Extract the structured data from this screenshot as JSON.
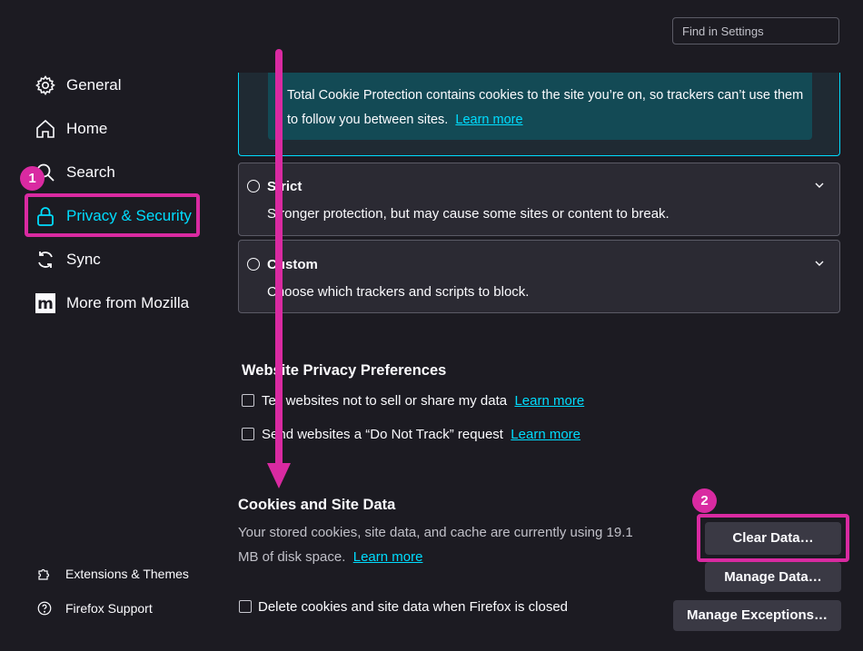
{
  "search": {
    "placeholder": "Find in Settings"
  },
  "sidebar": {
    "items": [
      {
        "label": "General",
        "icon": "gear-icon"
      },
      {
        "label": "Home",
        "icon": "home-icon"
      },
      {
        "label": "Search",
        "icon": "search-icon"
      },
      {
        "label": "Privacy & Security",
        "icon": "lock-icon",
        "active": true
      },
      {
        "label": "Sync",
        "icon": "sync-icon"
      },
      {
        "label": "More from Mozilla",
        "icon": "mozilla-icon"
      }
    ],
    "footer": [
      {
        "label": "Extensions & Themes",
        "icon": "puzzle-icon"
      },
      {
        "label": "Firefox Support",
        "icon": "help-icon"
      }
    ]
  },
  "annotations": {
    "step1": "1",
    "step2": "2",
    "accent": "#d92aa1"
  },
  "tracking": {
    "tcp_text": "Total Cookie Protection contains cookies to the site you’re on, so trackers can’t use them to follow you between sites.",
    "tcp_link": "Learn more",
    "options": [
      {
        "title": "Strict",
        "description": "Stronger protection, but may cause some sites or content to break."
      },
      {
        "title": "Custom",
        "description": "Choose which trackers and scripts to block."
      }
    ]
  },
  "privacy_prefs": {
    "title": "Website Privacy Preferences",
    "items": [
      {
        "label": "Tell websites not to sell or share my data",
        "link": "Learn more"
      },
      {
        "label": "Send websites a “Do Not Track” request",
        "link": "Learn more"
      }
    ]
  },
  "cookies": {
    "title": "Cookies and Site Data",
    "description": "Your stored cookies, site data, and cache are currently using 19.1 MB of disk space.",
    "link": "Learn more",
    "delete_label": "Delete cookies and site data when Firefox is closed",
    "buttons": {
      "clear": "Clear Data…",
      "manage": "Manage Data…",
      "exceptions": "Manage Exceptions…"
    }
  },
  "colors": {
    "accent": "#00ddff",
    "background": "#1c1b22",
    "highlight": "#d92aa1"
  }
}
